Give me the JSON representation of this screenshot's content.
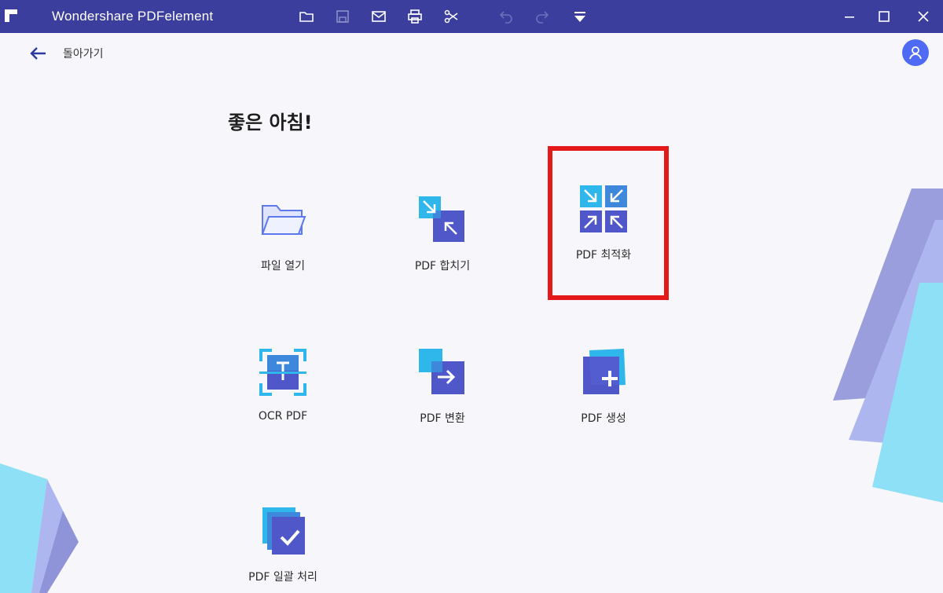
{
  "window": {
    "title": "Wondershare PDFelement",
    "colors": {
      "titlebar": "#3b3e9c",
      "accent": "#4f6bf6",
      "highlight": "#e41a1a"
    }
  },
  "toolbar": {
    "icons": [
      "folder-icon",
      "save-icon",
      "mail-icon",
      "print-icon",
      "scissors-icon",
      "undo-icon",
      "redo-icon",
      "dropdown-icon"
    ]
  },
  "header": {
    "back_label": "돌아가기"
  },
  "main": {
    "greeting": "좋은 아침!",
    "tiles": [
      {
        "label": "파일 열기",
        "icon": "open-folder-icon"
      },
      {
        "label": "PDF 합치기",
        "icon": "combine-pdf-icon"
      },
      {
        "label": "PDF 최적화",
        "icon": "optimize-pdf-icon"
      },
      {
        "label": "OCR PDF",
        "icon": "ocr-icon"
      },
      {
        "label": "PDF 변환",
        "icon": "convert-pdf-icon"
      },
      {
        "label": "PDF 생성",
        "icon": "create-pdf-icon"
      },
      {
        "label": "PDF 일괄 처리",
        "icon": "batch-process-icon"
      }
    ]
  }
}
